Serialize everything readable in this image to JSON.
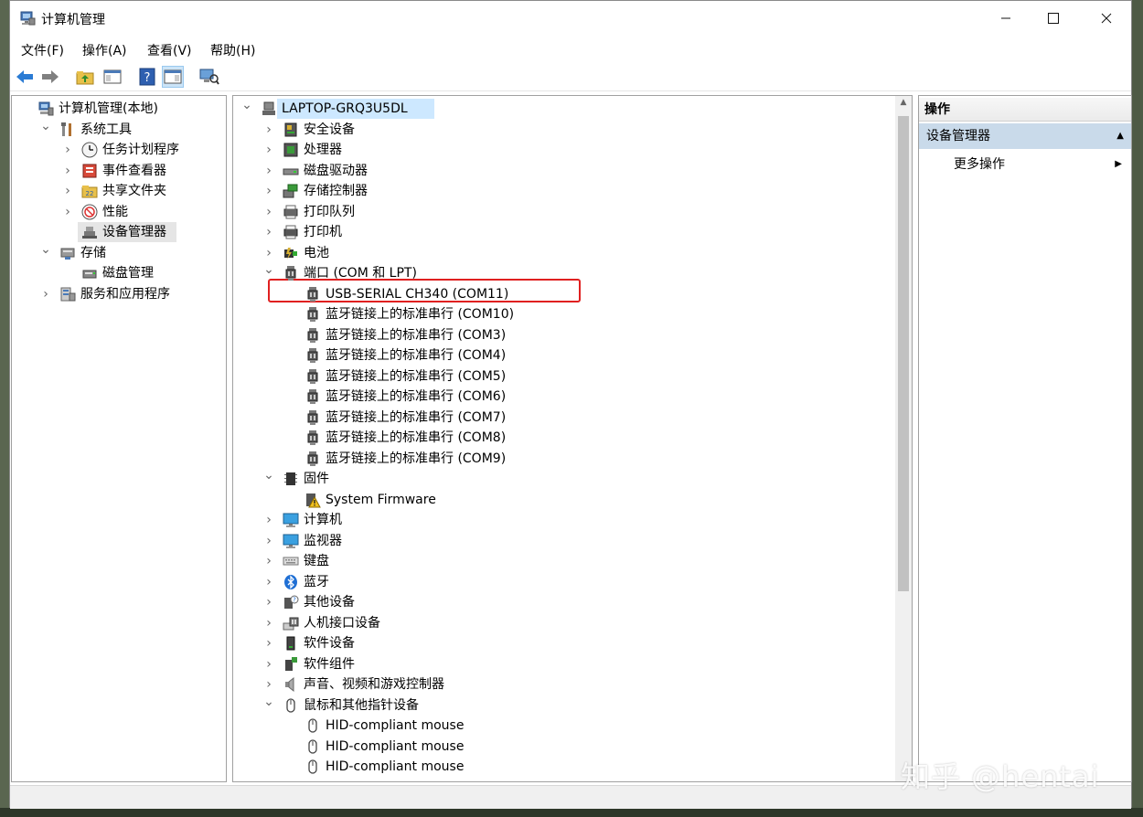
{
  "window": {
    "title": "计算机管理"
  },
  "menu": [
    "文件(F)",
    "操作(A)",
    "查看(V)",
    "帮助(H)"
  ],
  "left_tree": [
    {
      "label": "计算机管理(本地)",
      "indent": 0,
      "exp": "",
      "icon": "computer-management-icon"
    },
    {
      "label": "系统工具",
      "indent": 1,
      "exp": "v",
      "icon": "system-tools-icon"
    },
    {
      "label": "任务计划程序",
      "indent": 2,
      "exp": ">",
      "icon": "clock-icon"
    },
    {
      "label": "事件查看器",
      "indent": 2,
      "exp": ">",
      "icon": "event-viewer-icon"
    },
    {
      "label": "共享文件夹",
      "indent": 2,
      "exp": ">",
      "icon": "shared-folder-icon"
    },
    {
      "label": "性能",
      "indent": 2,
      "exp": ">",
      "icon": "performance-icon"
    },
    {
      "label": "设备管理器",
      "indent": 2,
      "exp": "",
      "icon": "device-manager-icon",
      "selected": true
    },
    {
      "label": "存储",
      "indent": 1,
      "exp": "v",
      "icon": "storage-icon"
    },
    {
      "label": "磁盘管理",
      "indent": 2,
      "exp": "",
      "icon": "disk-management-icon"
    },
    {
      "label": "服务和应用程序",
      "indent": 1,
      "exp": ">",
      "icon": "services-icon"
    }
  ],
  "device_tree": [
    {
      "label": "LAPTOP-GRQ3U5DL",
      "indent": 0,
      "exp": "v",
      "icon": "computer-node-icon",
      "root": true
    },
    {
      "label": "安全设备",
      "indent": 1,
      "exp": ">",
      "icon": "security-device-icon"
    },
    {
      "label": "处理器",
      "indent": 1,
      "exp": ">",
      "icon": "processor-icon"
    },
    {
      "label": "磁盘驱动器",
      "indent": 1,
      "exp": ">",
      "icon": "disk-drive-icon"
    },
    {
      "label": "存储控制器",
      "indent": 1,
      "exp": ">",
      "icon": "storage-controller-icon"
    },
    {
      "label": "打印队列",
      "indent": 1,
      "exp": ">",
      "icon": "print-queue-icon"
    },
    {
      "label": "打印机",
      "indent": 1,
      "exp": ">",
      "icon": "printer-icon"
    },
    {
      "label": "电池",
      "indent": 1,
      "exp": ">",
      "icon": "battery-icon"
    },
    {
      "label": "端口 (COM 和 LPT)",
      "indent": 1,
      "exp": "v",
      "icon": "port-icon"
    },
    {
      "label": "USB-SERIAL CH340 (COM11)",
      "indent": 2,
      "exp": "",
      "icon": "port-icon"
    },
    {
      "label": "蓝牙链接上的标准串行 (COM10)",
      "indent": 2,
      "exp": "",
      "icon": "port-icon"
    },
    {
      "label": "蓝牙链接上的标准串行 (COM3)",
      "indent": 2,
      "exp": "",
      "icon": "port-icon"
    },
    {
      "label": "蓝牙链接上的标准串行 (COM4)",
      "indent": 2,
      "exp": "",
      "icon": "port-icon"
    },
    {
      "label": "蓝牙链接上的标准串行 (COM5)",
      "indent": 2,
      "exp": "",
      "icon": "port-icon"
    },
    {
      "label": "蓝牙链接上的标准串行 (COM6)",
      "indent": 2,
      "exp": "",
      "icon": "port-icon"
    },
    {
      "label": "蓝牙链接上的标准串行 (COM7)",
      "indent": 2,
      "exp": "",
      "icon": "port-icon"
    },
    {
      "label": "蓝牙链接上的标准串行 (COM8)",
      "indent": 2,
      "exp": "",
      "icon": "port-icon"
    },
    {
      "label": "蓝牙链接上的标准串行 (COM9)",
      "indent": 2,
      "exp": "",
      "icon": "port-icon"
    },
    {
      "label": "固件",
      "indent": 1,
      "exp": "v",
      "icon": "firmware-icon"
    },
    {
      "label": "System Firmware",
      "indent": 2,
      "exp": "",
      "icon": "firmware-warning-icon"
    },
    {
      "label": "计算机",
      "indent": 1,
      "exp": ">",
      "icon": "monitor-icon"
    },
    {
      "label": "监视器",
      "indent": 1,
      "exp": ">",
      "icon": "monitor-icon"
    },
    {
      "label": "键盘",
      "indent": 1,
      "exp": ">",
      "icon": "keyboard-icon"
    },
    {
      "label": "蓝牙",
      "indent": 1,
      "exp": ">",
      "icon": "bluetooth-icon"
    },
    {
      "label": "其他设备",
      "indent": 1,
      "exp": ">",
      "icon": "unknown-device-icon"
    },
    {
      "label": "人机接口设备",
      "indent": 1,
      "exp": ">",
      "icon": "hid-icon"
    },
    {
      "label": "软件设备",
      "indent": 1,
      "exp": ">",
      "icon": "software-device-icon"
    },
    {
      "label": "软件组件",
      "indent": 1,
      "exp": ">",
      "icon": "software-component-icon"
    },
    {
      "label": "声音、视频和游戏控制器",
      "indent": 1,
      "exp": ">",
      "icon": "speaker-icon"
    },
    {
      "label": "鼠标和其他指针设备",
      "indent": 1,
      "exp": "v",
      "icon": "mouse-icon"
    },
    {
      "label": "HID-compliant mouse",
      "indent": 2,
      "exp": "",
      "icon": "mouse-icon"
    },
    {
      "label": "HID-compliant mouse",
      "indent": 2,
      "exp": "",
      "icon": "mouse-icon"
    },
    {
      "label": "HID-compliant mouse",
      "indent": 2,
      "exp": "",
      "icon": "mouse-icon"
    }
  ],
  "actions": {
    "header": "操作",
    "section": "设备管理器",
    "item": "更多操作"
  },
  "watermark": "知乎 @hentai",
  "colors": {
    "highlight": "#e02020",
    "action_section": "#c9daea",
    "selection": "#e5e5e5"
  }
}
